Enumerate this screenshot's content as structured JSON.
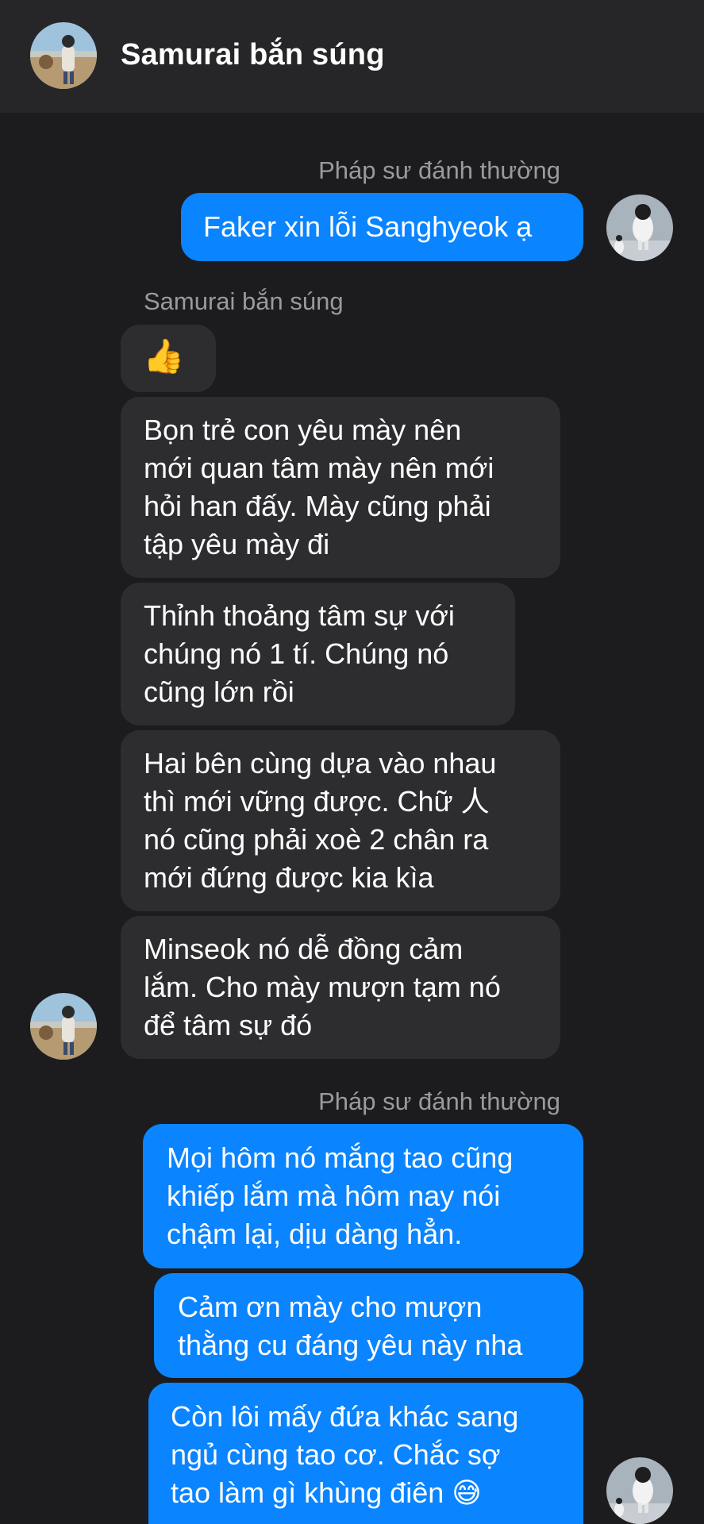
{
  "header": {
    "title": "Samurai bắn súng"
  },
  "thread": {
    "sender_me_1": "Pháp sư đánh thường",
    "msg_me_1": "Faker xin lỗi Sanghyeok ạ",
    "sender_other": "Samurai bắn súng",
    "msg_other_thumb": "👍",
    "msg_other_2": "Bọn trẻ con yêu mày nên\nmới quan tâm mày nên mới\nhỏi han đấy. Mày cũng phải\ntập yêu mày đi",
    "msg_other_3": "Thỉnh thoảng tâm sự với\nchúng nó 1 tí. Chúng nó\ncũng lớn rồi",
    "msg_other_4": "Hai bên cùng dựa vào nhau\nthì mới vững được. Chữ 人\nnó cũng phải xoè 2 chân ra\nmới đứng được kia kìa",
    "msg_other_5": "Minseok nó dễ đồng cảm\nlắm. Cho mày mượn tạm nó\nđể tâm sự đó",
    "sender_me_2": "Pháp sư đánh thường",
    "msg_me_2": "Mọi hôm nó mắng tao cũng\nkhiếp lắm mà hôm nay nói\nchậm lại, dịu dàng hẳn.",
    "msg_me_3": "Cảm ơn mày cho mượn\nthằng cu đáng yêu này nha",
    "msg_me_4": "Còn lôi mấy đứa khác sang\nngủ cùng tao cơ. Chắc sợ\ntao làm gì khùng điên 😅"
  },
  "colors": {
    "background": "#1c1c1e",
    "header": "#262628",
    "incoming_bubble": "#2d2d2f",
    "outgoing_bubble": "#0a84ff",
    "sender_label": "#9a9a9e"
  }
}
